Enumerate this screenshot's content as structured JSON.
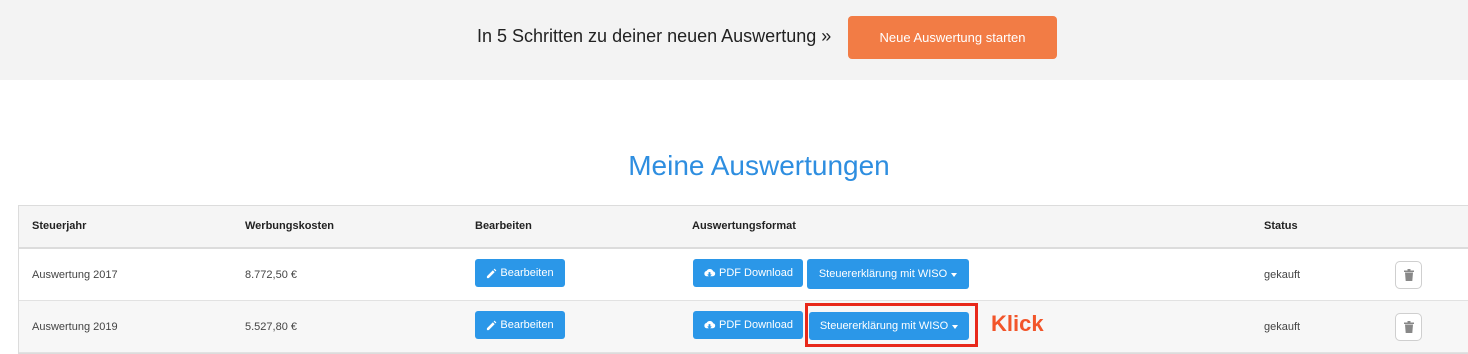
{
  "banner": {
    "text": "In 5 Schritten zu deiner neuen Auswertung »",
    "start_button": "Neue Auswertung starten"
  },
  "heading": "Meine Auswertungen",
  "table": {
    "headers": [
      "Steuerjahr",
      "Werbungskosten",
      "Bearbeiten",
      "Auswertungsformat",
      "Status"
    ],
    "rows": [
      {
        "year": "Auswertung 2017",
        "costs": "8.772,50 €",
        "edit_label": "Bearbeiten",
        "pdf_label": "PDF Download",
        "wiso_label": "Steuererklärung mit WISO",
        "status": "gekauft"
      },
      {
        "year": "Auswertung 2019",
        "costs": "5.527,80 €",
        "edit_label": "Bearbeiten",
        "pdf_label": "PDF Download",
        "wiso_label": "Steuererklärung mit WISO",
        "status": "gekauft"
      }
    ]
  },
  "annotation": {
    "label": "Klick",
    "color": "#e8281a"
  },
  "colors": {
    "accent_orange": "#f27c45",
    "accent_blue": "#2b97e8",
    "heading_blue": "#2e8ee0"
  },
  "icons": {
    "edit": "pencil-icon",
    "download": "cloud-download-icon",
    "dropdown": "caret-down-icon",
    "delete": "trash-icon"
  }
}
